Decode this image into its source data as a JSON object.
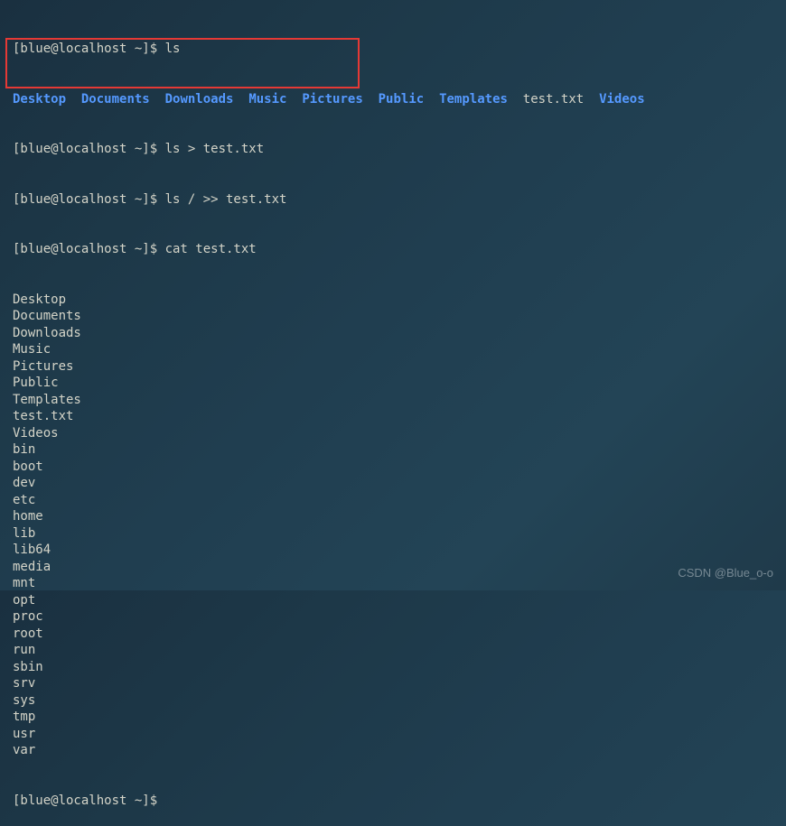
{
  "prompt": "[blue@localhost ~]$ ",
  "commands": {
    "ls": "ls",
    "ls_redirect": "ls > test.txt",
    "ls_append": "ls / >> test.txt",
    "cat": "cat test.txt"
  },
  "ls_output": [
    {
      "name": "Desktop",
      "type": "dir"
    },
    {
      "name": "Documents",
      "type": "dir"
    },
    {
      "name": "Downloads",
      "type": "dir"
    },
    {
      "name": "Music",
      "type": "dir"
    },
    {
      "name": "Pictures",
      "type": "dir"
    },
    {
      "name": "Public",
      "type": "dir"
    },
    {
      "name": "Templates",
      "type": "dir"
    },
    {
      "name": "test.txt",
      "type": "file"
    },
    {
      "name": "Videos",
      "type": "dir"
    }
  ],
  "cat_output": [
    "Desktop",
    "Documents",
    "Downloads",
    "Music",
    "Pictures",
    "Public",
    "Templates",
    "test.txt",
    "Videos",
    "bin",
    "boot",
    "dev",
    "etc",
    "home",
    "lib",
    "lib64",
    "media",
    "mnt",
    "opt",
    "proc",
    "root",
    "run",
    "sbin",
    "srv",
    "sys",
    "tmp",
    "usr",
    "var"
  ],
  "watermark": "CSDN @Blue_o-o"
}
